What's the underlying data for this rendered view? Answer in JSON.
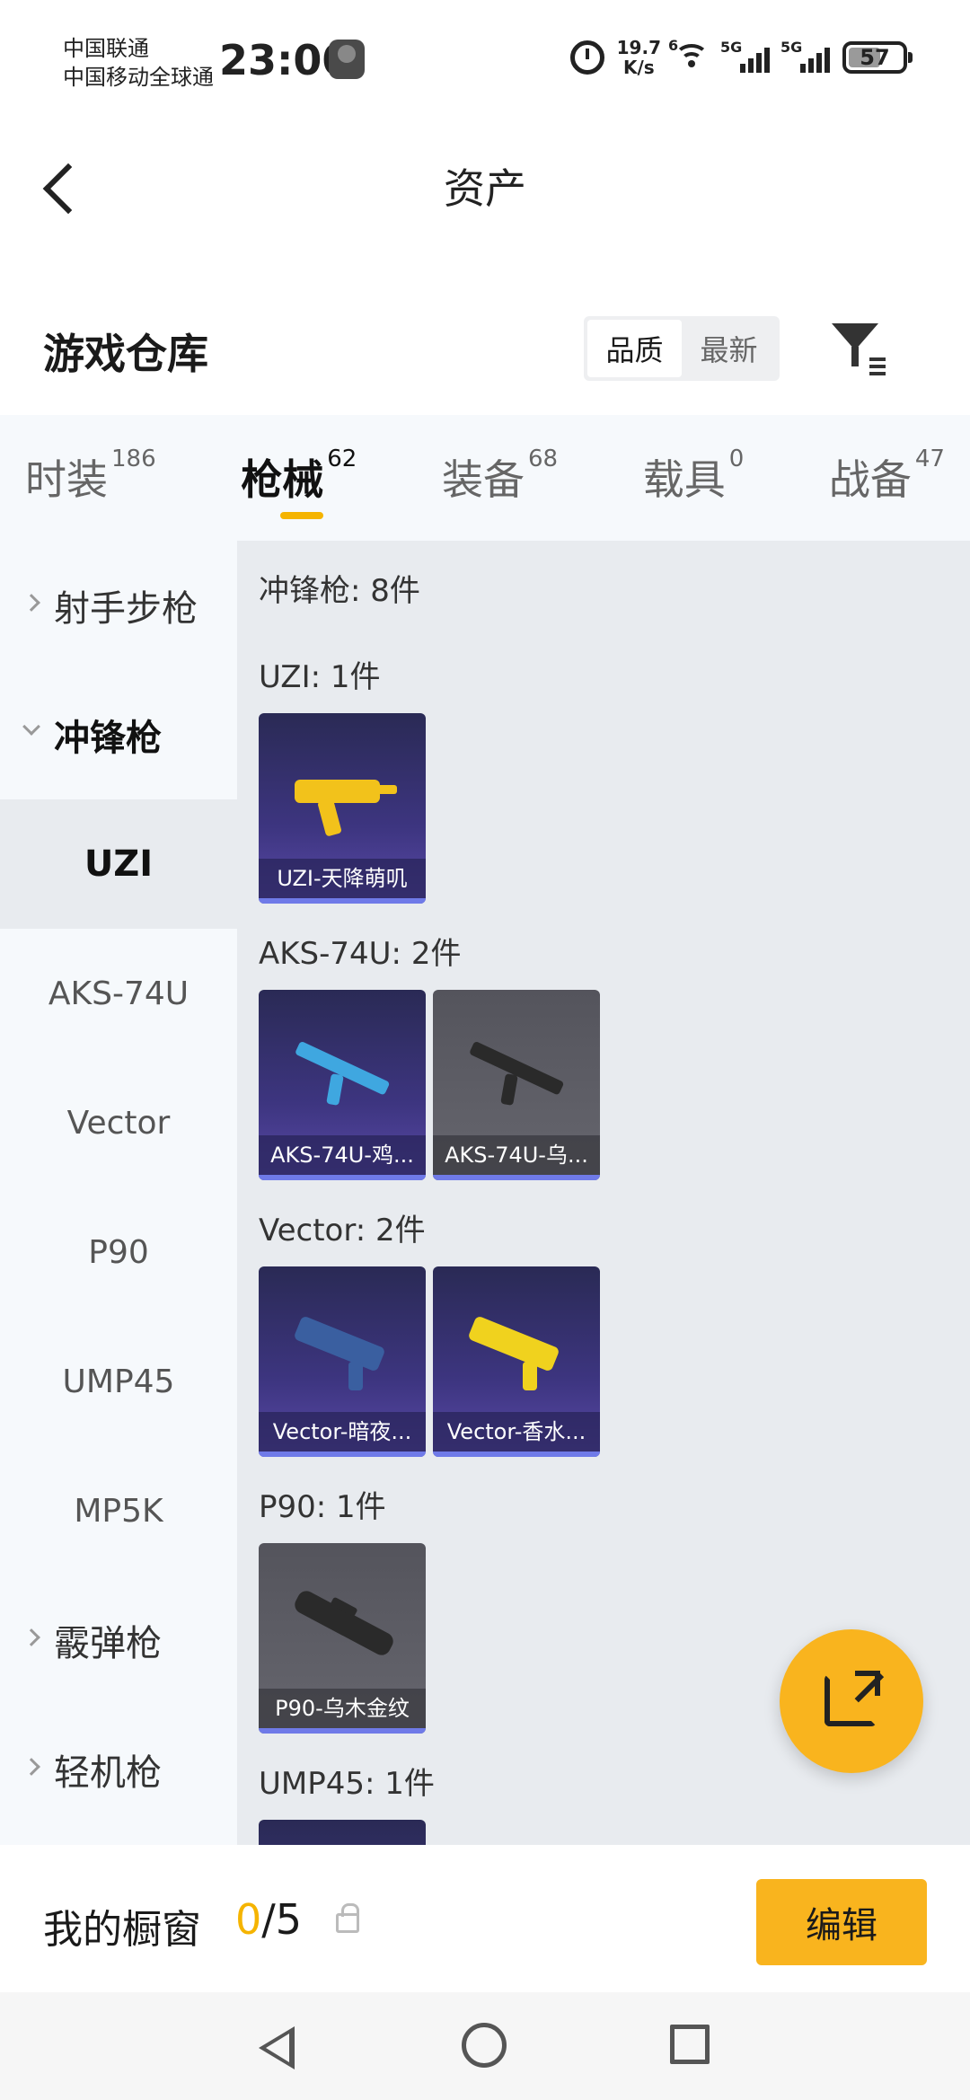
{
  "status_bar": {
    "carrier_1": "中国联通",
    "carrier_2": "中国移动全球通",
    "time": "23:00",
    "net_speed_value": "19.7",
    "net_speed_unit": "K/s",
    "wifi_badge": "6",
    "signal_1_label": "5G",
    "signal_2_label": "5G",
    "battery": "57"
  },
  "header": {
    "title": "资产"
  },
  "warehouse": {
    "title": "游戏仓库",
    "sort_options": [
      "品质",
      "最新"
    ],
    "active_sort": "品质"
  },
  "category_tabs": [
    {
      "label": "时装",
      "count": "186"
    },
    {
      "label": "枪械",
      "count": "62"
    },
    {
      "label": "装备",
      "count": "68"
    },
    {
      "label": "载具",
      "count": "0"
    },
    {
      "label": "战备",
      "count": "47"
    }
  ],
  "active_category": "枪械",
  "side_nav": [
    {
      "label": "射手步枪",
      "type": "group"
    },
    {
      "label": "冲锋枪",
      "type": "group-open"
    },
    {
      "label": "UZI",
      "type": "selected"
    },
    {
      "label": "AKS-74U",
      "type": "sub"
    },
    {
      "label": "Vector",
      "type": "sub"
    },
    {
      "label": "P90",
      "type": "sub"
    },
    {
      "label": "UMP45",
      "type": "sub"
    },
    {
      "label": "MP5K",
      "type": "sub"
    },
    {
      "label": "霰弹枪",
      "type": "group"
    },
    {
      "label": "轻机枪",
      "type": "group"
    }
  ],
  "content": {
    "category_summary": "冲锋枪: 8件",
    "sections": [
      {
        "header": "UZI: 1件",
        "items": [
          {
            "name": "UZI-天降萌叽",
            "style": "purple",
            "weapon_color": "#f2c21b"
          }
        ]
      },
      {
        "header": "AKS-74U: 2件",
        "items": [
          {
            "name": "AKS-74U-鸡...",
            "style": "purple",
            "weapon_color": "#3fa7e0"
          },
          {
            "name": "AKS-74U-乌...",
            "style": "gray",
            "weapon_color": "#2a2a2a"
          }
        ]
      },
      {
        "header": "Vector: 2件",
        "items": [
          {
            "name": "Vector-暗夜...",
            "style": "purple",
            "weapon_color": "#3a5fa0"
          },
          {
            "name": "Vector-香水...",
            "style": "purple",
            "weapon_color": "#f0d21e"
          }
        ]
      },
      {
        "header": "P90: 1件",
        "items": [
          {
            "name": "P90-乌木金纹",
            "style": "gray",
            "weapon_color": "#2a2a2a"
          }
        ]
      },
      {
        "header": "UMP45: 1件",
        "items": []
      }
    ]
  },
  "showcase": {
    "title": "我的橱窗",
    "current": "0",
    "total": "/5",
    "edit_label": "编辑"
  },
  "colors": {
    "accent": "#f9b41e",
    "underline": "#f5b400",
    "rarity_purple": "#3d3580",
    "rarity_bar": "#6f7ae8"
  }
}
